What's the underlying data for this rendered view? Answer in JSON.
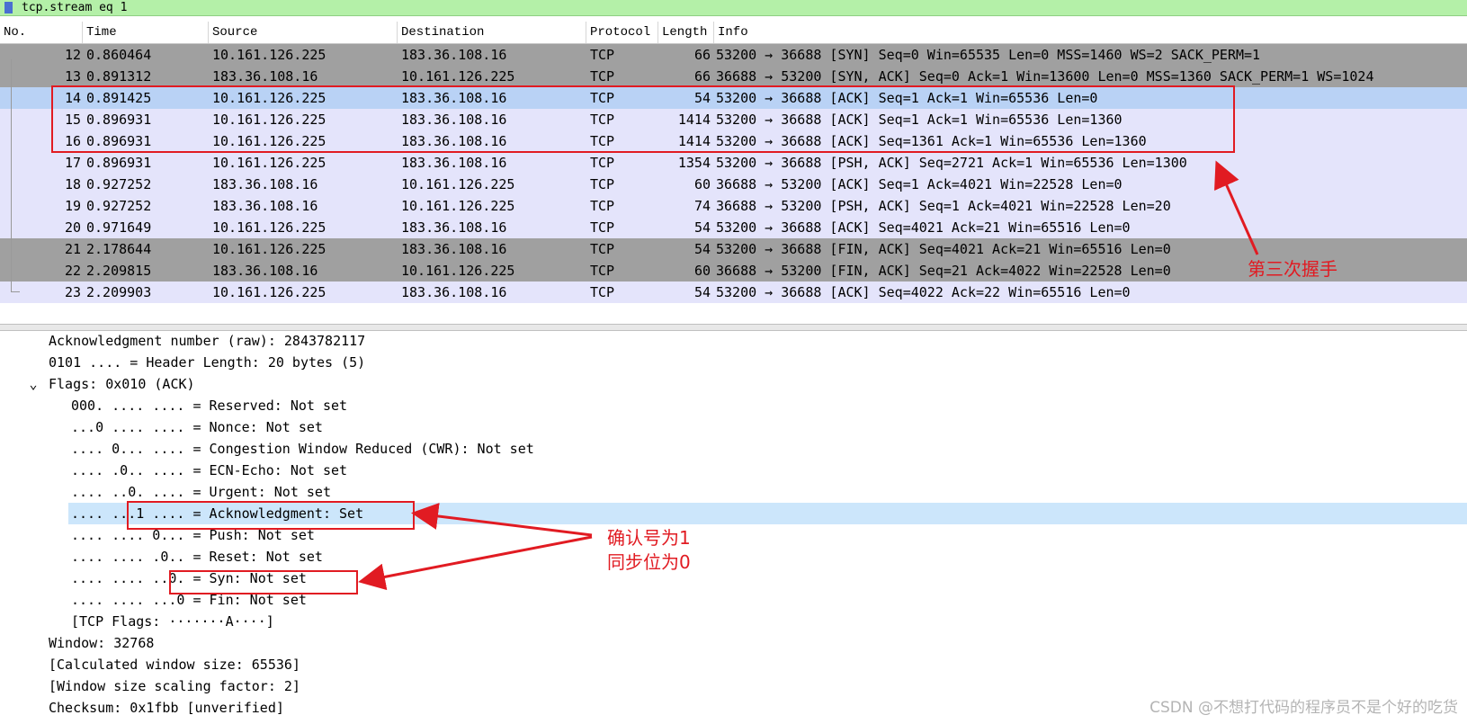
{
  "filter": {
    "text": "tcp.stream eq 1"
  },
  "columns": [
    "No.",
    "Time",
    "Source",
    "Destination",
    "Protocol",
    "Length",
    "Info"
  ],
  "packets": [
    {
      "no": "12",
      "time": "0.860464",
      "src": "10.161.126.225",
      "dst": "183.36.108.16",
      "proto": "TCP",
      "len": "66",
      "info": "53200 → 36688 [SYN] Seq=0 Win=65535 Len=0 MSS=1460 WS=2 SACK_PERM=1"
    },
    {
      "no": "13",
      "time": "0.891312",
      "src": "183.36.108.16",
      "dst": "10.161.126.225",
      "proto": "TCP",
      "len": "66",
      "info": "36688 → 53200 [SYN, ACK] Seq=0 Ack=1 Win=13600 Len=0 MSS=1360 SACK_PERM=1 WS=1024"
    },
    {
      "no": "14",
      "time": "0.891425",
      "src": "10.161.126.225",
      "dst": "183.36.108.16",
      "proto": "TCP",
      "len": "54",
      "info": "53200 → 36688 [ACK] Seq=1 Ack=1 Win=65536 Len=0"
    },
    {
      "no": "15",
      "time": "0.896931",
      "src": "10.161.126.225",
      "dst": "183.36.108.16",
      "proto": "TCP",
      "len": "1414",
      "info": "53200 → 36688 [ACK] Seq=1 Ack=1 Win=65536 Len=1360"
    },
    {
      "no": "16",
      "time": "0.896931",
      "src": "10.161.126.225",
      "dst": "183.36.108.16",
      "proto": "TCP",
      "len": "1414",
      "info": "53200 → 36688 [ACK] Seq=1361 Ack=1 Win=65536 Len=1360"
    },
    {
      "no": "17",
      "time": "0.896931",
      "src": "10.161.126.225",
      "dst": "183.36.108.16",
      "proto": "TCP",
      "len": "1354",
      "info": "53200 → 36688 [PSH, ACK] Seq=2721 Ack=1 Win=65536 Len=1300"
    },
    {
      "no": "18",
      "time": "0.927252",
      "src": "183.36.108.16",
      "dst": "10.161.126.225",
      "proto": "TCP",
      "len": "60",
      "info": "36688 → 53200 [ACK] Seq=1 Ack=4021 Win=22528 Len=0"
    },
    {
      "no": "19",
      "time": "0.927252",
      "src": "183.36.108.16",
      "dst": "10.161.126.225",
      "proto": "TCP",
      "len": "74",
      "info": "36688 → 53200 [PSH, ACK] Seq=1 Ack=4021 Win=22528 Len=20"
    },
    {
      "no": "20",
      "time": "0.971649",
      "src": "10.161.126.225",
      "dst": "183.36.108.16",
      "proto": "TCP",
      "len": "54",
      "info": "53200 → 36688 [ACK] Seq=4021 Ack=21 Win=65516 Len=0"
    },
    {
      "no": "21",
      "time": "2.178644",
      "src": "10.161.126.225",
      "dst": "183.36.108.16",
      "proto": "TCP",
      "len": "54",
      "info": "53200 → 36688 [FIN, ACK] Seq=4021 Ack=21 Win=65516 Len=0"
    },
    {
      "no": "22",
      "time": "2.209815",
      "src": "183.36.108.16",
      "dst": "10.161.126.225",
      "proto": "TCP",
      "len": "60",
      "info": "36688 → 53200 [FIN, ACK] Seq=21 Ack=4022 Win=22528 Len=0"
    },
    {
      "no": "23",
      "time": "2.209903",
      "src": "10.161.126.225",
      "dst": "183.36.108.16",
      "proto": "TCP",
      "len": "54",
      "info": "53200 → 36688 [ACK] Seq=4022 Ack=22 Win=65516 Len=0"
    }
  ],
  "details": [
    "Acknowledgment number (raw): 2843782117",
    "0101 .... = Header Length: 20 bytes (5)",
    "Flags: 0x010 (ACK)",
    "000. .... .... = Reserved: Not set",
    "...0 .... .... = Nonce: Not set",
    ".... 0... .... = Congestion Window Reduced (CWR): Not set",
    ".... .0.. .... = ECN-Echo: Not set",
    ".... ..0. .... = Urgent: Not set",
    ".... ...1 .... = Acknowledgment: Set",
    ".... .... 0... = Push: Not set",
    ".... .... .0.. = Reset: Not set",
    ".... .... ..0. = Syn: Not set",
    ".... .... ...0 = Fin: Not set",
    "[TCP Flags: ·······A····]",
    "Window: 32768",
    "[Calculated window size: 65536]",
    "[Window size scaling factor: 2]",
    "Checksum: 0x1fbb [unverified]"
  ],
  "annotations": {
    "third_handshake": "第三次握手",
    "ack_number": "确认号为1",
    "syn_bit": "同步位为0"
  },
  "watermark": "CSDN @不想打代码的程序员不是个好的吃货",
  "colors": {
    "tcp_row": "#e4e4fb",
    "fin_row": "#a0a0a0",
    "selected_row": "#b9d2f5",
    "annotation": "#e11b22",
    "filter_bg": "#b4f0a8"
  }
}
